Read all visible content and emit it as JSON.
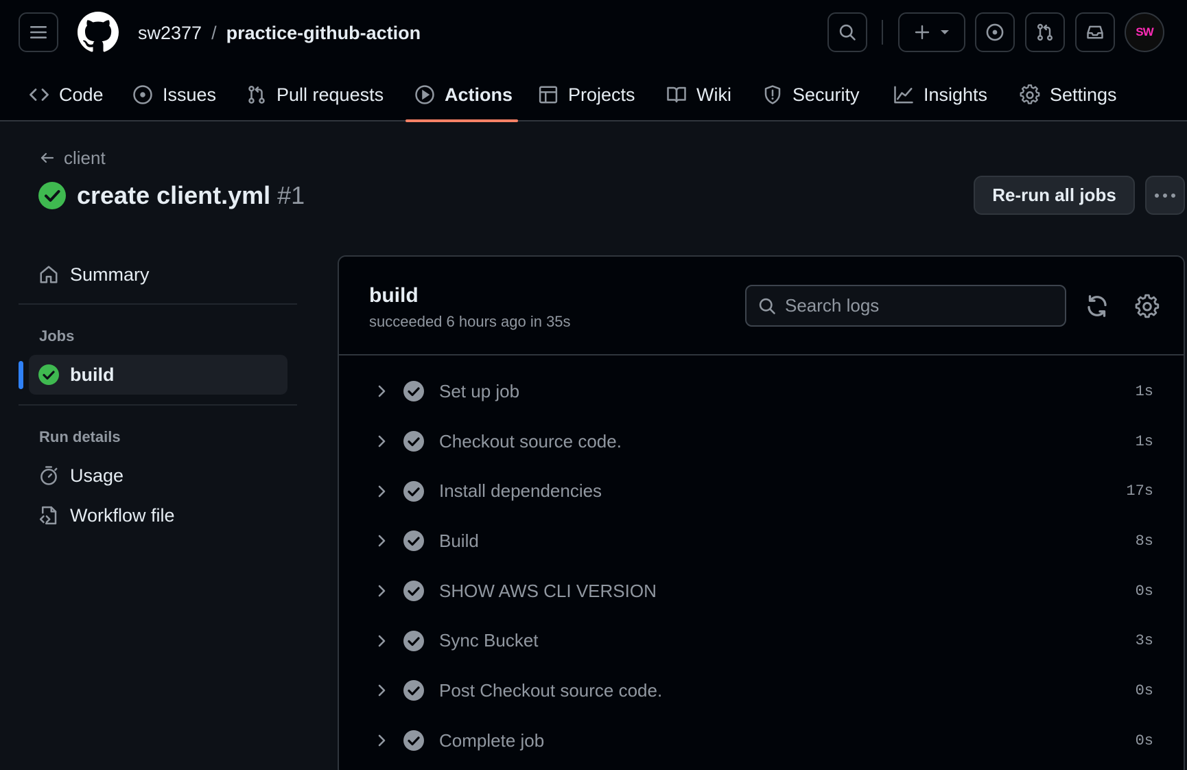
{
  "header": {
    "owner": "sw2377",
    "separator": "/",
    "repo": "practice-github-action",
    "avatar_text": "SW"
  },
  "tabs": [
    {
      "label": "Code",
      "icon": "code-icon"
    },
    {
      "label": "Issues",
      "icon": "issue-icon"
    },
    {
      "label": "Pull requests",
      "icon": "pull-request-icon"
    },
    {
      "label": "Actions",
      "icon": "play-icon",
      "active": true
    },
    {
      "label": "Projects",
      "icon": "table-icon"
    },
    {
      "label": "Wiki",
      "icon": "book-icon"
    },
    {
      "label": "Security",
      "icon": "shield-icon"
    },
    {
      "label": "Insights",
      "icon": "graph-icon"
    },
    {
      "label": "Settings",
      "icon": "gear-icon"
    }
  ],
  "run": {
    "back_label": "client",
    "title": "create client.yml",
    "number": "#1",
    "rerun_label": "Re-run all jobs",
    "status": "success"
  },
  "sidebar": {
    "summary_label": "Summary",
    "jobs_heading": "Jobs",
    "job_label": "build",
    "run_details_heading": "Run details",
    "usage_label": "Usage",
    "workflow_file_label": "Workflow file"
  },
  "job": {
    "name": "build",
    "status_text": "succeeded 6 hours ago in 35s",
    "search_placeholder": "Search logs",
    "steps": [
      {
        "label": "Set up job",
        "duration": "1s"
      },
      {
        "label": "Checkout source code.",
        "duration": "1s"
      },
      {
        "label": "Install dependencies",
        "duration": "17s"
      },
      {
        "label": "Build",
        "duration": "8s"
      },
      {
        "label": "SHOW AWS CLI VERSION",
        "duration": "0s"
      },
      {
        "label": "Sync Bucket",
        "duration": "3s"
      },
      {
        "label": "Post Checkout source code.",
        "duration": "0s"
      },
      {
        "label": "Complete job",
        "duration": "0s"
      }
    ]
  },
  "colors": {
    "success": "#3fb950",
    "step_check": "#9198a1",
    "accent_underline": "#f78166",
    "active_job_marker": "#2f81f7"
  }
}
